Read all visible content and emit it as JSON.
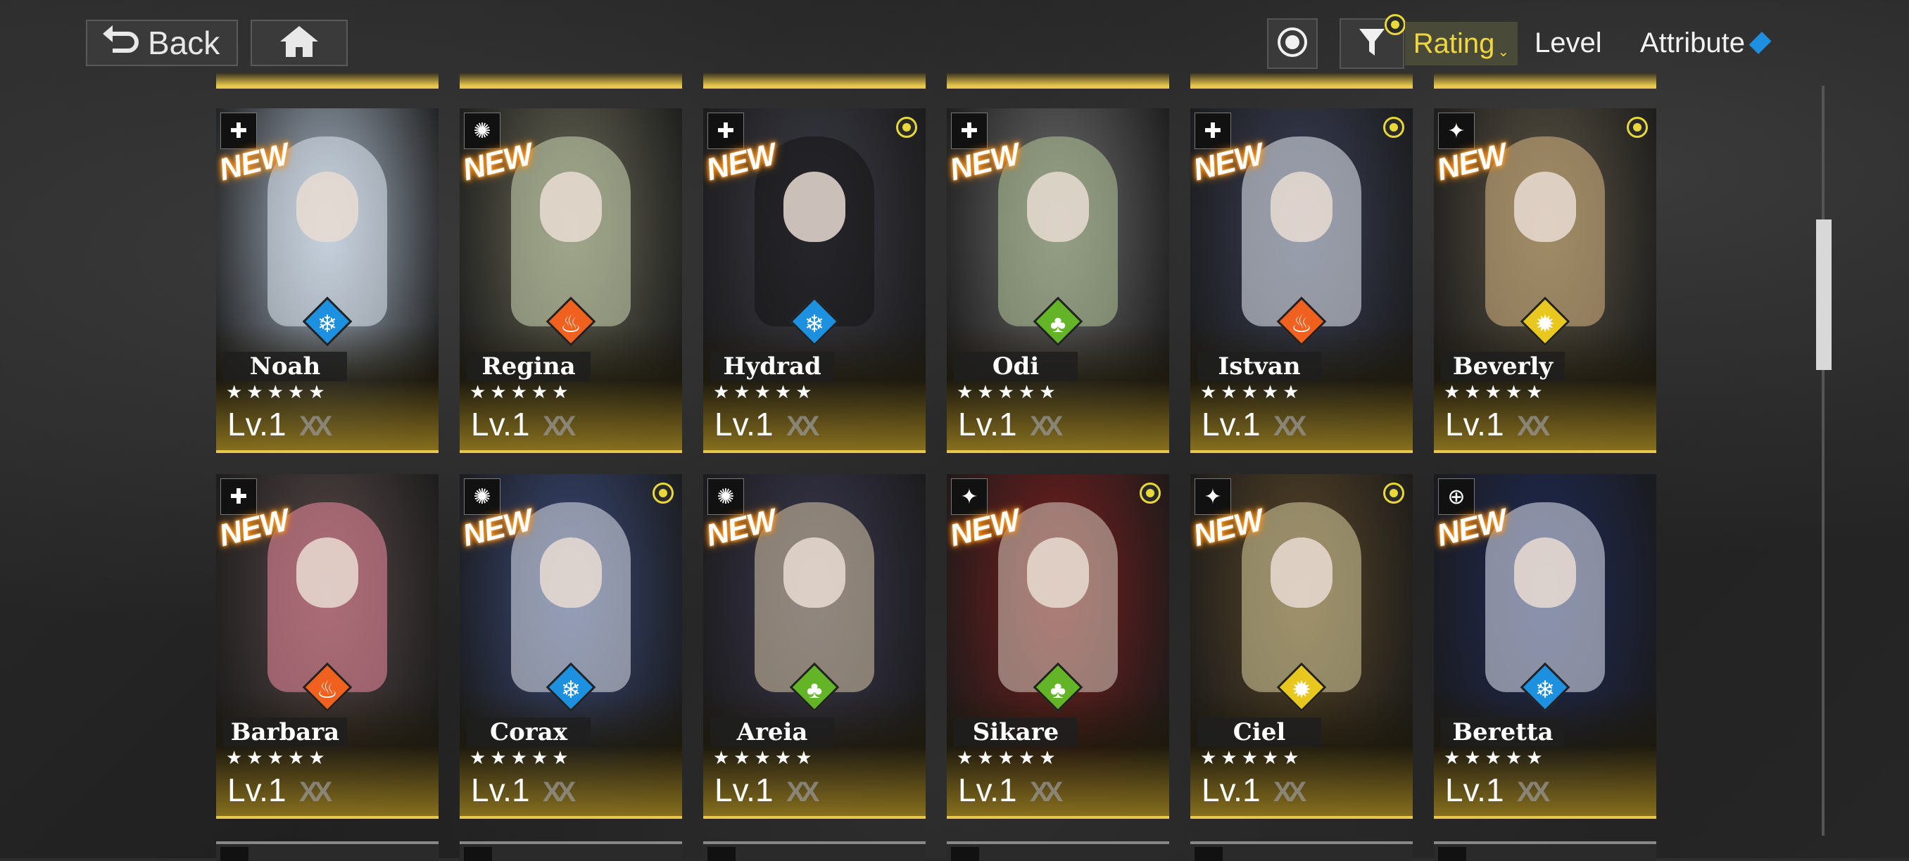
{
  "topbar": {
    "back_label": "Back",
    "back_icon": "return-arrow-icon",
    "home_icon": "home-icon",
    "target_icon": "target-icon",
    "filter_icon": "filter-icon",
    "rating_label": "Rating",
    "level_label": "Level",
    "attribute_label": "Attribute"
  },
  "colors": {
    "accent": "#e6c84a",
    "new_glow": "#ff8a00"
  },
  "cards": [
    {
      "name": "Noah",
      "stars": "★★★★★",
      "level": "Lv.1",
      "limit": "XX",
      "new": "NEW",
      "element": "ice",
      "elem_color": "#1e90e0",
      "glyph": "❄",
      "cls": "✚",
      "art": "#aab8c8",
      "hair": "#dfe8f0",
      "yel": false
    },
    {
      "name": "Regina",
      "stars": "★★★★★",
      "level": "Lv.1",
      "limit": "XX",
      "new": "NEW",
      "element": "fire",
      "elem_color": "#f0601e",
      "glyph": "♨",
      "cls": "✺",
      "art": "#6a6a58",
      "hair": "#cdd8b4",
      "yel": false
    },
    {
      "name": "Hydrad",
      "stars": "★★★★★",
      "level": "Lv.1",
      "limit": "XX",
      "new": "NEW",
      "element": "ice",
      "elem_color": "#1e90e0",
      "glyph": "❄",
      "cls": "✚",
      "art": "#3c3c48",
      "hair": "#141414",
      "yel": true
    },
    {
      "name": "Odi",
      "stars": "★★★★★",
      "level": "Lv.1",
      "limit": "XX",
      "new": "NEW",
      "element": "nature",
      "elem_color": "#64b428",
      "glyph": "♣",
      "cls": "✚",
      "art": "#6e6e6e",
      "hair": "#b4c89a",
      "yel": false
    },
    {
      "name": "Istvan",
      "stars": "★★★★★",
      "level": "Lv.1",
      "limit": "XX",
      "new": "NEW",
      "element": "fire",
      "elem_color": "#f0601e",
      "glyph": "♨",
      "cls": "✚",
      "art": "#3a4058",
      "hair": "#e8ecf4",
      "yel": true
    },
    {
      "name": "Beverly",
      "stars": "★★★★★",
      "level": "Lv.1",
      "limit": "XX",
      "new": "NEW",
      "element": "electric",
      "elem_color": "#e8c81e",
      "glyph": "✹",
      "cls": "✦",
      "art": "#5e5646",
      "hair": "#d8b884",
      "yel": true
    },
    {
      "name": "Barbara",
      "stars": "★★★★★",
      "level": "Lv.1",
      "limit": "XX",
      "new": "NEW",
      "element": "fire",
      "elem_color": "#f0601e",
      "glyph": "♨",
      "cls": "✚",
      "art": "#584848",
      "hair": "#f08ca0",
      "yel": false
    },
    {
      "name": "Corax",
      "stars": "★★★★★",
      "level": "Lv.1",
      "limit": "XX",
      "new": "NEW",
      "element": "ice",
      "elem_color": "#1e90e0",
      "glyph": "❄",
      "cls": "✺",
      "art": "#3a4a7a",
      "hair": "#e0e4ec",
      "yel": true
    },
    {
      "name": "Areia",
      "stars": "★★★★★",
      "level": "Lv.1",
      "limit": "XX",
      "new": "NEW",
      "element": "nature",
      "elem_color": "#64b428",
      "glyph": "♣",
      "cls": "✺",
      "art": "#3a3850",
      "hair": "#d8c8a8",
      "yel": false
    },
    {
      "name": "Sikare",
      "stars": "★★★★★",
      "level": "Lv.1",
      "limit": "XX",
      "new": "NEW",
      "element": "nature",
      "elem_color": "#64b428",
      "glyph": "♣",
      "cls": "✦",
      "art": "#7a1e1e",
      "hair": "#d8ccc0",
      "yel": true
    },
    {
      "name": "Ciel",
      "stars": "★★★★★",
      "level": "Lv.1",
      "limit": "XX",
      "new": "NEW",
      "element": "electric",
      "elem_color": "#e8c81e",
      "glyph": "✹",
      "cls": "✦",
      "art": "#5a4628",
      "hair": "#d8d0a0",
      "yel": true
    },
    {
      "name": "Beretta",
      "stars": "★★★★★",
      "level": "Lv.1",
      "limit": "XX",
      "new": "NEW",
      "element": "ice",
      "elem_color": "#1e90e0",
      "glyph": "❄",
      "cls": "⊕",
      "art": "#1e2a58",
      "hair": "#e4e8f4",
      "yel": false
    }
  ]
}
